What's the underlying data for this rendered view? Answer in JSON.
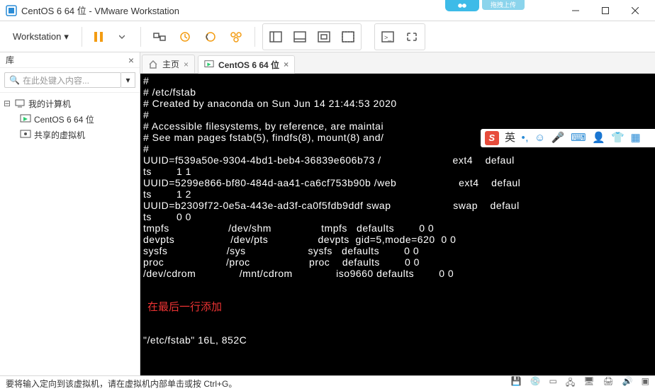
{
  "window": {
    "title": "CentOS 6 64 位 - VMware Workstation"
  },
  "bluetag": "拖拽上传",
  "menu": {
    "workstation": "Workstation",
    "dropdown_arrow": "▾"
  },
  "sidebar": {
    "title": "库",
    "search_placeholder": "在此处键入内容...",
    "tree": {
      "root": "我的计算机",
      "item1": "CentOS 6 64 位",
      "item2": "共享的虚拟机"
    }
  },
  "tabs": {
    "home": "主页",
    "vm": "CentOS 6 64 位"
  },
  "ime": {
    "lang": "英"
  },
  "console_lines": [
    "#",
    "# /etc/fstab",
    "# Created by anaconda on Sun Jun 14 21:44:53 2020",
    "#",
    "# Accessible filesystems, by reference, are maintai",
    "# See man pages fstab(5), findfs(8), mount(8) and/",
    "#",
    "UUID=f539a50e-9304-4bd1-beb4-36839e606b73 /                       ext4    defaul",
    "ts        1 1",
    "UUID=5299e866-bf80-484d-aa41-ca6cf753b90b /web                    ext4    defaul",
    "ts        1 2",
    "UUID=b2309f72-0e5a-443e-ad3f-ca0f5fdb9ddf swap                    swap    defaul",
    "ts        0 0",
    "tmpfs                   /dev/shm                tmpfs   defaults        0 0",
    "devpts                  /dev/pts                devpts  gid=5,mode=620  0 0",
    "sysfs                   /sys                    sysfs   defaults        0 0",
    "proc                    /proc                   proc    defaults        0 0",
    "/dev/cdrom              /mnt/cdrom              iso9660 defaults        0 0"
  ],
  "console_annotation": "在最后一行添加",
  "console_footer": "\"/etc/fstab\" 16L, 852C",
  "statusbar": {
    "text": "要将输入定向到该虚拟机，请在虚拟机内部单击或按 Ctrl+G。"
  }
}
